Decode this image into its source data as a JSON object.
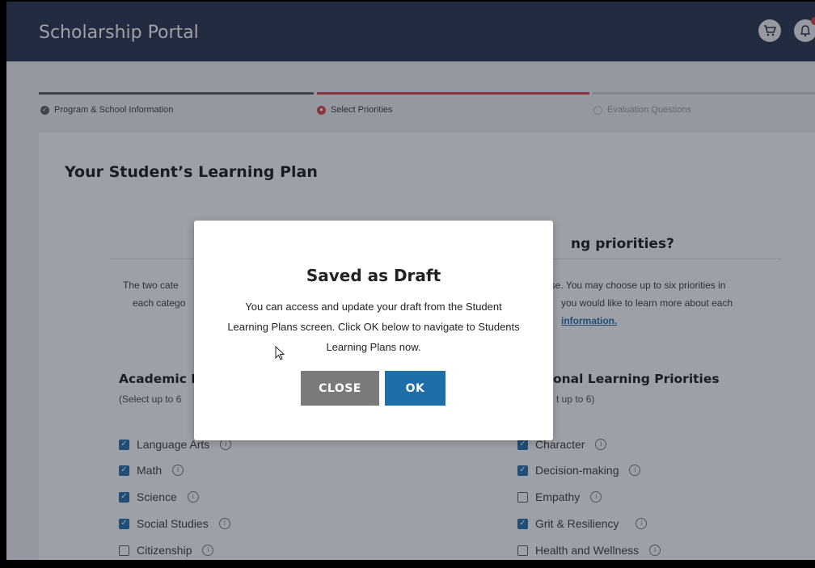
{
  "app": {
    "title": "Scholarship Portal"
  },
  "header_icons": [
    "cart-icon",
    "bell-icon"
  ],
  "steps": [
    {
      "label": "Program & School Information",
      "status": "complete"
    },
    {
      "label": "Select Priorities",
      "status": "current"
    },
    {
      "label": "Evaluation Questions",
      "status": "pending"
    }
  ],
  "page": {
    "title": "Your Student’s Learning Plan",
    "question_fragment": "ng priorities?",
    "desc_left_1": "The two cate",
    "desc_left_2": "each catego",
    "desc_right_1": "ose. You may choose up to six priorities in",
    "desc_right_2": "you would like to learn more about each",
    "desc_right_3": "information."
  },
  "academic": {
    "title": "Academic I",
    "subtitle": "(Select up to 6",
    "items": [
      {
        "label": "Language Arts",
        "checked": true
      },
      {
        "label": "Math",
        "checked": true
      },
      {
        "label": "Science",
        "checked": true
      },
      {
        "label": "Social Studies",
        "checked": true
      },
      {
        "label": "Citizenship",
        "checked": false
      }
    ]
  },
  "personal": {
    "title": "onal Learning Priorities",
    "subtitle": "t up to 6)",
    "items": [
      {
        "label": "Character",
        "checked": true
      },
      {
        "label": "Decision-making",
        "checked": true
      },
      {
        "label": "Empathy",
        "checked": false
      },
      {
        "label": "Grit & Resiliency",
        "checked": true
      },
      {
        "label": "Health and Wellness",
        "checked": false
      }
    ]
  },
  "modal": {
    "title": "Saved as Draft",
    "body": "You can access and update your draft from the Student Learning Plans screen. Click OK below to navigate to Students Learning Plans now.",
    "close_label": "CLOSE",
    "ok_label": "OK"
  },
  "colors": {
    "header": "#1f2a44",
    "accent_red": "#d83a3a",
    "link_blue": "#1a6aa8",
    "close_button": "#7a7a7a",
    "ok_button": "#1e6ea8"
  }
}
